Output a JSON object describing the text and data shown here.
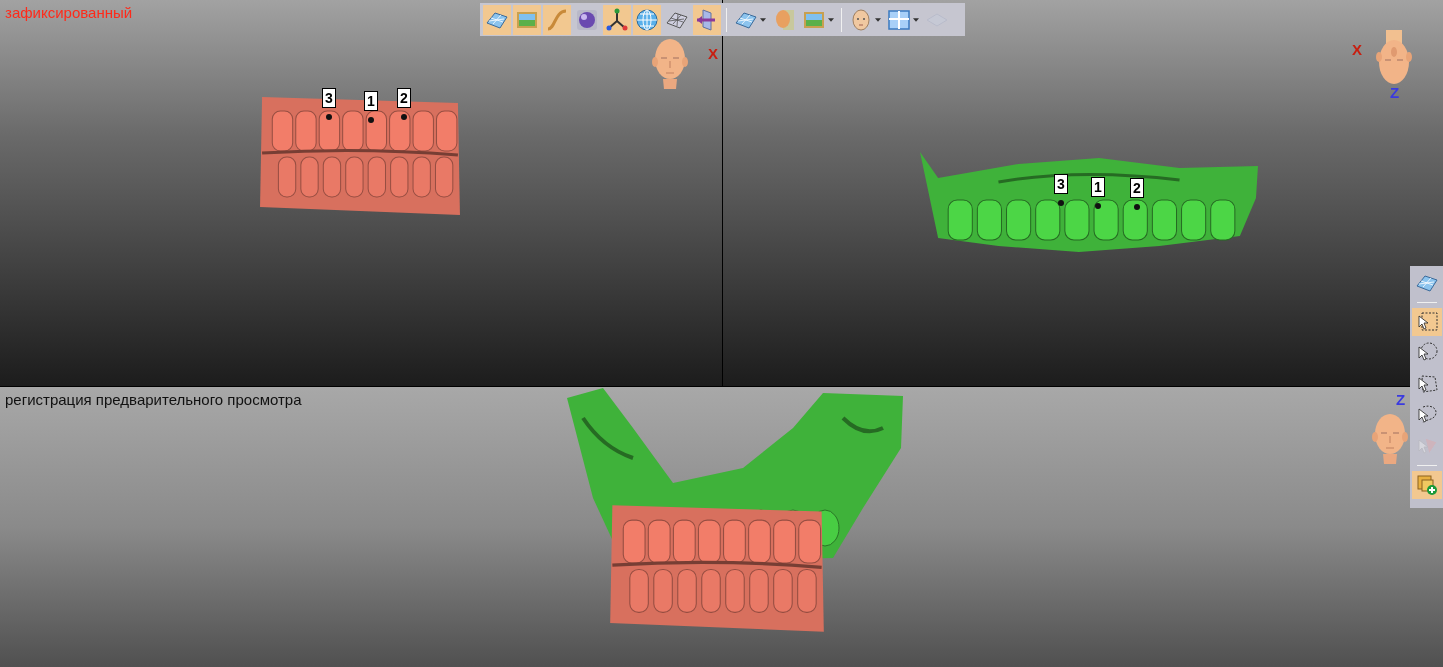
{
  "toolbar": {
    "buttons": [
      {
        "kind": "mesh",
        "selected": true,
        "dropdown": false,
        "disabled": false
      },
      {
        "kind": "image",
        "selected": true,
        "dropdown": false,
        "disabled": false
      },
      {
        "kind": "curve",
        "selected": true,
        "dropdown": false,
        "disabled": false
      },
      {
        "kind": "sphere",
        "selected": false,
        "dropdown": false,
        "disabled": false
      },
      {
        "kind": "axes",
        "selected": true,
        "dropdown": false,
        "disabled": false
      },
      {
        "kind": "globe",
        "selected": true,
        "dropdown": false,
        "disabled": false
      },
      {
        "kind": "wire",
        "selected": false,
        "dropdown": false,
        "disabled": false
      },
      {
        "kind": "plane",
        "selected": true,
        "dropdown": false,
        "disabled": false
      },
      {
        "kind": "separator"
      },
      {
        "kind": "mesh",
        "selected": false,
        "dropdown": true,
        "disabled": false
      },
      {
        "kind": "head",
        "selected": false,
        "dropdown": false,
        "disabled": false
      },
      {
        "kind": "image",
        "selected": false,
        "dropdown": true,
        "disabled": false
      },
      {
        "kind": "separator"
      },
      {
        "kind": "face",
        "selected": false,
        "dropdown": true,
        "disabled": false
      },
      {
        "kind": "layout",
        "selected": false,
        "dropdown": true,
        "disabled": false
      },
      {
        "kind": "layer",
        "selected": false,
        "dropdown": false,
        "disabled": true
      }
    ]
  },
  "side_toolbar": {
    "buttons": [
      {
        "kind": "mesh",
        "selected": false,
        "disabled": false
      },
      {
        "kind": "separator"
      },
      {
        "kind": "rect-select",
        "selected": true,
        "disabled": false
      },
      {
        "kind": "circle-select",
        "selected": false,
        "disabled": false
      },
      {
        "kind": "poly-select",
        "selected": false,
        "disabled": false
      },
      {
        "kind": "lasso-select",
        "selected": false,
        "disabled": false
      },
      {
        "kind": "pick",
        "selected": false,
        "disabled": true
      },
      {
        "kind": "separator"
      },
      {
        "kind": "add-layer",
        "selected": true,
        "disabled": false
      }
    ]
  },
  "viewports": [
    {
      "title": "зафиксированный",
      "color": "#ff2a1a",
      "head": {
        "kind": "front"
      },
      "axes": [
        {
          "label": "X",
          "color": "#c81e10"
        }
      ],
      "markers": [
        {
          "label": "3"
        },
        {
          "label": "1"
        },
        {
          "label": "2"
        }
      ],
      "models": [
        {
          "color": "#d8705e"
        }
      ]
    },
    {
      "head": {
        "kind": "top"
      },
      "axes": [
        {
          "label": "X",
          "color": "#c81e10"
        },
        {
          "label": "Z",
          "color": "#3a3ae0"
        }
      ],
      "markers": [
        {
          "label": "3"
        },
        {
          "label": "1"
        },
        {
          "label": "2"
        }
      ],
      "models": [
        {
          "color": "#3fb23a"
        }
      ]
    },
    {
      "title": "регистрация предварительного просмотра",
      "color": "#111111",
      "head": {
        "kind": "front"
      },
      "axes": [
        {
          "label": "Z",
          "color": "#3a3ae0"
        }
      ],
      "models": [
        {
          "color": "#3fb23a"
        },
        {
          "color": "#d8705e"
        }
      ]
    }
  ]
}
